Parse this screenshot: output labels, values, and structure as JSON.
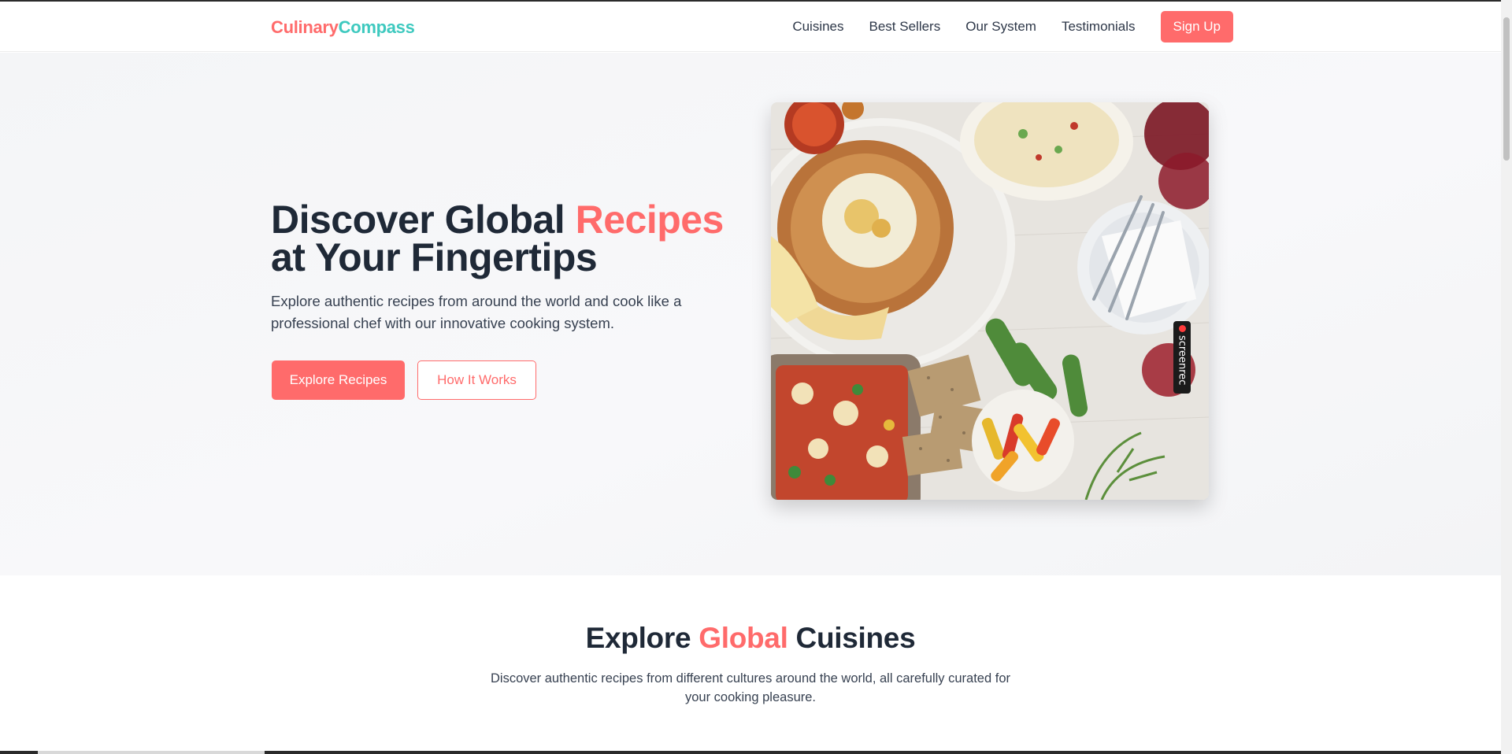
{
  "brand": {
    "part1": "Culinary",
    "part2": "Compass"
  },
  "nav": {
    "links": [
      "Cuisines",
      "Best Sellers",
      "Our System",
      "Testimonials"
    ],
    "signup_label": "Sign Up"
  },
  "hero": {
    "title_part1": "Discover Global ",
    "title_accent": "Recipes",
    "title_part2": "at Your Fingertips",
    "subtitle": "Explore authentic recipes from around the world and cook like a professional chef with our innovative cooking system.",
    "primary_button": "Explore Recipes",
    "secondary_button": "How It Works"
  },
  "recording_badge": {
    "text": "screenrec"
  },
  "cuisines_section": {
    "title_part1": "Explore ",
    "title_accent": "Global",
    "title_part2": " Cuisines",
    "subtitle": "Discover authentic recipes from different cultures around the world, all carefully curated for your cooking pleasure."
  },
  "colors": {
    "accent": "#ff6b6b",
    "brand_secondary": "#3ec9bf",
    "text_dark": "#1f2937"
  }
}
